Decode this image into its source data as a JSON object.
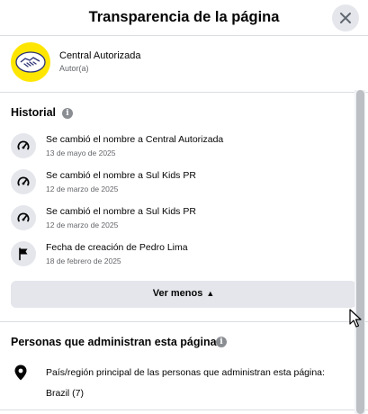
{
  "dialog": {
    "title": "Transparencia de la página"
  },
  "author": {
    "name": "Central Autorizada",
    "role": "Autor(a)"
  },
  "history": {
    "title": "Historial",
    "items": [
      {
        "icon": "name-change-icon",
        "text": "Se cambió el nombre a Central Autorizada",
        "date": "13 de mayo de 2025"
      },
      {
        "icon": "name-change-icon",
        "text": "Se cambió el nombre a Sul Kids PR",
        "date": "12 de marzo de 2025"
      },
      {
        "icon": "name-change-icon",
        "text": "Se cambió el nombre a Sul Kids PR",
        "date": "12 de marzo de 2025"
      },
      {
        "icon": "flag-icon",
        "text": "Fecha de creación de Pedro Lima",
        "date": "18 de febrero de 2025"
      }
    ],
    "see_less_label": "Ver menos"
  },
  "admins": {
    "title": "Personas que administran esta página",
    "location_label": "País/región principal de las personas que administran esta página:",
    "location_value": "Brazil (7)"
  },
  "colors": {
    "avatar_bg": "#ffe600",
    "button_bg": "#e4e6eb",
    "secondary_text": "#65676b"
  }
}
